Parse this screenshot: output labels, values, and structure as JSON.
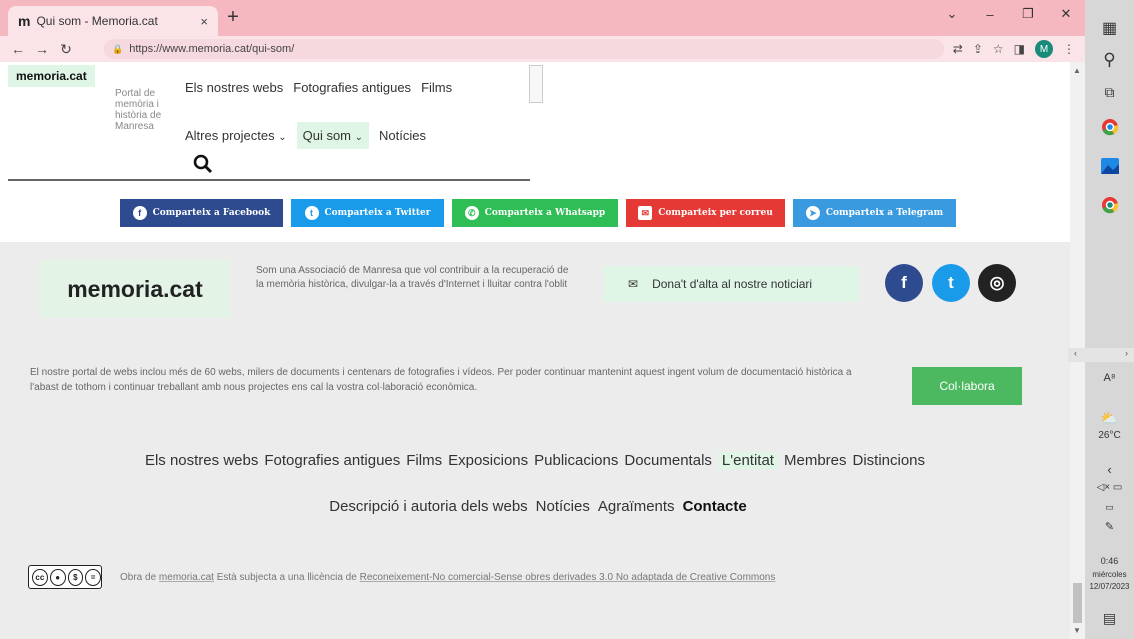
{
  "browser": {
    "tab_title": "Qui som - Memoria.cat",
    "tab_favicon": "m",
    "tab_close": "×",
    "new_tab": "+",
    "url": "https://www.memoria.cat/qui-som/",
    "avatar_initial": "M",
    "accent_color": "#f5b8c1"
  },
  "header": {
    "logo": "memoria.cat",
    "tagline": "Portal de memòria i història de Manresa",
    "nav_top": [
      "Els nostres webs",
      "Fotografies antigues",
      "Films"
    ],
    "nav_bottom": {
      "altres": "Altres projectes",
      "qui_som": "Qui som",
      "noticies": "Notícies"
    }
  },
  "share": {
    "facebook": "Comparteix a Facebook",
    "twitter": "Comparteix a Twitter",
    "whatsapp": "Comparteix a Whatsapp",
    "email": "Comparteix per correu",
    "telegram": "Comparteix a Telegram"
  },
  "footer": {
    "logo": "memoria.cat",
    "description": "Som una Associació de Manresa que vol contribuir a la recuperació de la memòria històrica, divulgar-la a través d'Internet i lluitar contra l'oblit",
    "newsletter": "Dona't d'alta al nostre noticiari",
    "support_text": "El nostre portal de webs inclou més de 60 webs, milers de documents i centenars de fotografies i vídeos. Per poder continuar mantenint aquest ingent volum de documentació històrica a l'abast de tothom i continuar treballant amb nous projectes ens cal la vostra col·laboració econòmica.",
    "collab_button": "Col·labora",
    "nav1": [
      "Els nostres webs",
      "Fotografies antigues",
      "Films",
      "Exposicions",
      "Publicacions",
      "Documentals",
      "L'entitat",
      "Membres",
      "Distincions"
    ],
    "nav2": [
      "Descripció i autoria dels webs",
      "Notícies",
      "Agraïments",
      "Contacte"
    ],
    "license_prefix": "Obra de",
    "license_site": "memoria.cat",
    "license_mid": "Està subjecta a una llicència de",
    "license_link": "Reconeixement-No comercial-Sense obres derivades 3.0 No adaptada de Creative Commons",
    "cc_badge": "cc"
  },
  "taskbar": {
    "temperature": "26°C",
    "time": "0:46",
    "day": "miércoles",
    "date": "12/07/2023"
  }
}
